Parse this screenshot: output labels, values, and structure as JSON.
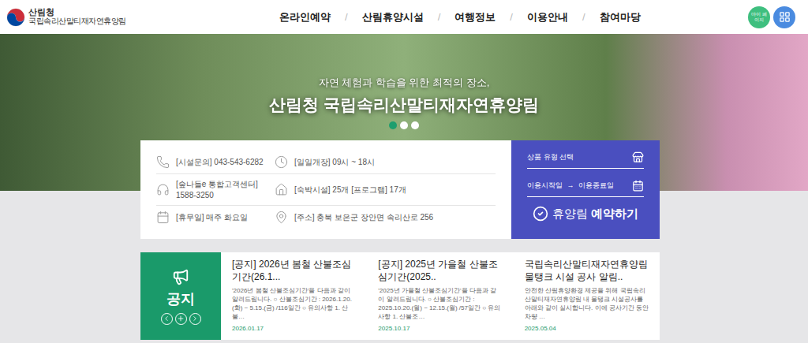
{
  "header": {
    "logo": {
      "agency": "산림청",
      "name": "국립속리산말티재자연휴양림"
    },
    "nav": [
      {
        "label": "온라인예약"
      },
      {
        "label": "산림휴양시설"
      },
      {
        "label": "여행정보"
      },
      {
        "label": "이용안내"
      },
      {
        "label": "참여마당"
      }
    ],
    "separator": "/",
    "mypage": "마이 페이지"
  },
  "hero": {
    "subtitle": "자연 체험과 학습을 위한 최적의 장소,",
    "title": "산림청 국립속리산말티재자연휴양림",
    "slides": [
      {
        "selected": true
      },
      {
        "selected": false
      },
      {
        "selected": false
      }
    ]
  },
  "info": {
    "rows": [
      [
        {
          "kind": "phone",
          "text": "[시설문의] 043-543-6282"
        },
        {
          "kind": "clock",
          "text": "[일일개장] 09시 ~ 18시"
        }
      ],
      [
        {
          "kind": "headset",
          "text": "[숲나들e 통합고객센터] 1588-3250"
        },
        {
          "kind": "house",
          "text": "[숙박시설] 25개 [프로그램] 17개"
        }
      ],
      [
        {
          "kind": "calendar",
          "text": "[휴무일] 매주 화요일"
        },
        {
          "kind": "pin",
          "text": "[주소] 충북 보은군 장안면 속리산로 256"
        }
      ]
    ]
  },
  "booking": {
    "type": "상품 유형 선택",
    "start": "이용시작일",
    "arrow": "→",
    "end": "이용종료일",
    "button_light": "휴양림",
    "button_bold": "예약하기"
  },
  "notice": {
    "title": "공지",
    "items": [
      {
        "title": "[공지] 2026년 봄철 산불조심기간(26.1...",
        "snippet": "'2026년 봄철 산불조심기간'을 다음과 같이 알려드립니다. ○ 산불조심기간 : 2026.1.20.(화) ~ 5.15.(금) /116일간 ○ 유의사항 1. 산불…",
        "date": "2026.01.17"
      },
      {
        "title": "[공지] 2025년 가을철 산불조심기간(2025..",
        "snippet": "'2025년 가을철 산불조심기간'을 다음과 같이 알려드립니다. ○ 산불조심기간 : 2025.10.20.(월) ~ 12.15.(월) /57일간 ○ 유의사항 1. 산불조…",
        "date": "2025.10.17"
      },
      {
        "title": "국립속리산말티재자연휴양림 물탱크 시설 공사 알림..",
        "snippet": "안전한 산림휴양환경 제공을 위해 국립속리산말티재자연휴양림 내 물탱크 시설공사를 아래와 같이 실시합니다. 이에 공사기간 동안 차량 …",
        "date": "2025.05.04"
      }
    ]
  }
}
